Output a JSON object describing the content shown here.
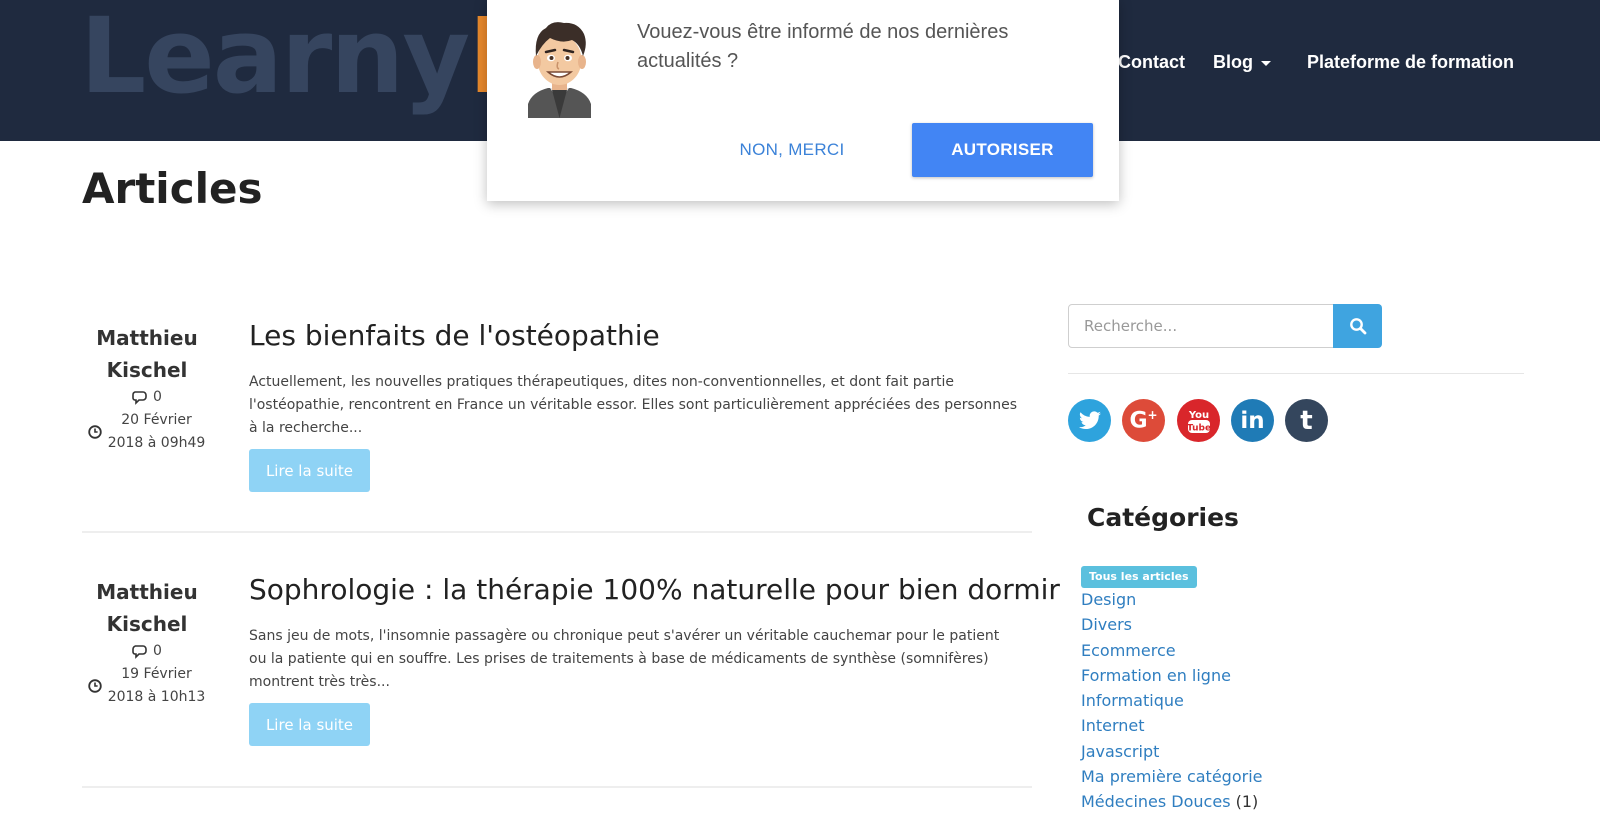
{
  "header": {
    "logo_main": "LearnyB",
    "logo_plain": "Learny",
    "logo_accent": "B",
    "nav": [
      {
        "label": "Contact"
      },
      {
        "label": "Blog"
      },
      {
        "label": "Plateforme de formation"
      }
    ]
  },
  "popup": {
    "message": "Vouez-vous être informé de nos dernières actualités ?",
    "deny_label": "NON, MERCI",
    "allow_label": "AUTORISER"
  },
  "main": {
    "title": "Articles",
    "articles": [
      {
        "author": "Matthieu Kischel",
        "comments": "0",
        "date": "20 Février 2018 à 09h49",
        "title": "Les bienfaits de l'ostéopathie",
        "excerpt": "Actuellement, les nouvelles pratiques thérapeutiques, dites non-conventionnelles,  et dont fait partie l'ostéopathie, rencontrent en France un véritable essor. Elles sont particulièrement appréciées des personnes à la recherche...",
        "read_more": "Lire la suite"
      },
      {
        "author": "Matthieu Kischel",
        "comments": "0",
        "date": "19 Février 2018 à 10h13",
        "title": "Sophrologie : la thérapie 100% naturelle pour bien dormir",
        "excerpt": "Sans jeu de mots, l'insomnie passagère ou chronique peut s'avérer un véritable cauchemar pour le patient ou la patiente qui en souffre. Les prises de traitements à base de médicaments de synthèse (somnifères) montrent très très...",
        "read_more": "Lire la suite"
      }
    ]
  },
  "sidebar": {
    "search_placeholder": "Recherche...",
    "social": [
      {
        "name": "twitter-icon",
        "color": "#2ea3dd"
      },
      {
        "name": "google-plus-icon",
        "color": "#dd4b39"
      },
      {
        "name": "youtube-icon",
        "color": "#d9262b"
      },
      {
        "name": "linkedin-icon",
        "color": "#1f7bb6"
      },
      {
        "name": "tumblr-icon",
        "color": "#34465d"
      }
    ],
    "categories_title": "Catégories",
    "all_label": "Tous les articles",
    "categories": [
      {
        "label": "Design",
        "count": ""
      },
      {
        "label": "Divers",
        "count": ""
      },
      {
        "label": "Ecommerce",
        "count": ""
      },
      {
        "label": "Formation en ligne",
        "count": ""
      },
      {
        "label": "Informatique",
        "count": ""
      },
      {
        "label": "Internet",
        "count": ""
      },
      {
        "label": "Javascript",
        "count": ""
      },
      {
        "label": "Ma première catégorie",
        "count": ""
      },
      {
        "label": "Médecines Douces",
        "count": "(1)"
      }
    ]
  },
  "colors": {
    "header_bg": "#1f2a3f",
    "logo_accent": "#e8892c",
    "primary_button": "#4285f4",
    "link": "#2f7ec0",
    "read_more_bg": "#8fd3f5"
  }
}
